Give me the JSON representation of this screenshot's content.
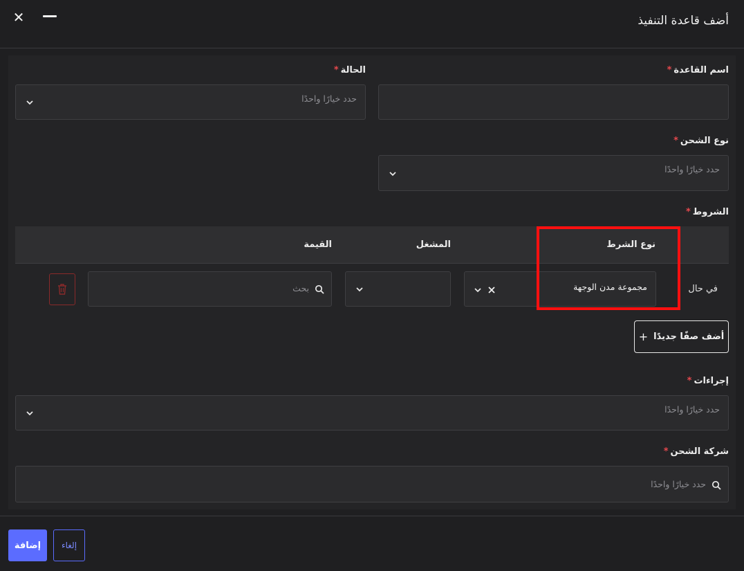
{
  "header": {
    "title": "أضف قاعدة التنفيذ",
    "close_glyph": "✕"
  },
  "form": {
    "rule_name": {
      "label": "اسم القاعدة",
      "required": "*",
      "value": ""
    },
    "status": {
      "label": "الحالة",
      "required": "*",
      "placeholder": "حدد خيارًا واحدًا"
    },
    "shipping_type": {
      "label": "نوع الشحن",
      "required": "*",
      "placeholder": "حدد خيارًا واحدًا"
    },
    "conditions": {
      "label": "الشروط",
      "required": "*",
      "columns": [
        "نوع الشرط",
        "المشغل",
        "القيمة"
      ],
      "rows": [
        {
          "prefix": "في حال",
          "condition_type": "مجموعة مدن الوجهة",
          "operator": "",
          "value_placeholder": "بحث"
        }
      ],
      "add_row_label": "أضف صفًا جديدًا",
      "add_row_glyph": "+"
    },
    "actions": {
      "label": "إجراءات",
      "required": "*",
      "placeholder": "حدد خيارًا واحدًا"
    },
    "shipping_company": {
      "label": "شركة الشحن",
      "required": "*",
      "placeholder": "حدد خيارًا واحدًا"
    }
  },
  "footer": {
    "add_label": "إضافة",
    "cancel_label": "إلغاء"
  },
  "colors": {
    "primary": "#5b6cff",
    "danger": "#e5484d",
    "highlight": "#ff1010"
  }
}
